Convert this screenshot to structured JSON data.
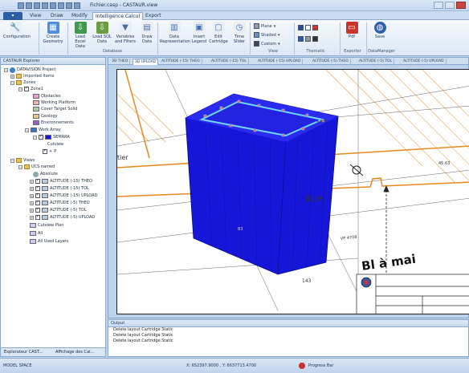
{
  "window": {
    "title": "Fichier.casp - CASTAUR.view"
  },
  "tabs": {
    "file": "",
    "view": "View",
    "draw": "Draw",
    "modify": "Modify",
    "active": "Intelligence Calcul",
    "export": "Export"
  },
  "ribbon": {
    "configuration": "Configuration",
    "create_geometry": "Create Geometry",
    "load_excel": "Load Excel Data",
    "load_sql": "Load SQL Data",
    "variables": "Variables and Filters",
    "draw_data": "Draw Data",
    "data_repr": "Data Representation",
    "insert_legend": "Insert Legend",
    "edit_cartridge": "Edit Cartridge",
    "time": "Time Slider",
    "plane": "Plane",
    "shaded": "Shaded",
    "custom": "Custom",
    "pdf": "Pdf",
    "save": "Save",
    "group_database": "Database",
    "group_view": "View",
    "group_thematic": "Thematic",
    "group_exporter": "Exporter",
    "group_datamanager": "DataManager"
  },
  "explorer": {
    "title": "CASTAUR Explorer",
    "items": [
      "DATAVISION Project",
      "Imported Items",
      "Zones",
      "Zone1",
      "Obstacles",
      "Working Platform",
      "Cover Target Solid",
      "Geology",
      "Environnements",
      "Work Array",
      "SEMARA",
      "Cutview",
      "P",
      "Views",
      "UCS named",
      "Absolute",
      "ALTITUDE (-15) THEO",
      "ALTITUDE (-15) TOL",
      "ALTITUDE (-15) UPLOAD",
      "ALTITUDE (-5) THEO",
      "ALTITUDE (-5) TOL",
      "ALTITUDE (-5) UPLOAD",
      "Cutview Plan",
      "All",
      "All Used Layers"
    ],
    "tab1": "Explorateur CAST...",
    "tab2": "Affichage des Cal..."
  },
  "doctabs": [
    "3D THEO",
    "3D UPLOAD",
    "ALTITUDE (-15) THEO",
    "ALTITUDE (-15) TOL",
    "ALTITUDE (-15) UPLOAD",
    "ALTITUDE (-5) THEO",
    "ALTITUDE (-5) TOL",
    "ALTITUDE (-5) UPLOAD"
  ],
  "drawing": {
    "label1": "tier",
    "label2": "Rue",
    "label3": "Bl à mai",
    "label4": "VP 4708",
    "label5": "B3",
    "label6": "143",
    "label7": "4.53",
    "label8": "45.63"
  },
  "output": {
    "title": "Output",
    "lines": [
      "Delete layout Cartridge Static",
      "Delete layout Cartridge Static",
      "Delete layout Cartridge Static"
    ]
  },
  "status": {
    "mode": "MODEL SPACE",
    "coords": "X: 652397.9000 , Y: 6637713.4700",
    "progress": "Progress Bar"
  },
  "colors": {
    "solid": "#1616d8",
    "accent": "#2a5da6",
    "orange": "#e8891e"
  }
}
